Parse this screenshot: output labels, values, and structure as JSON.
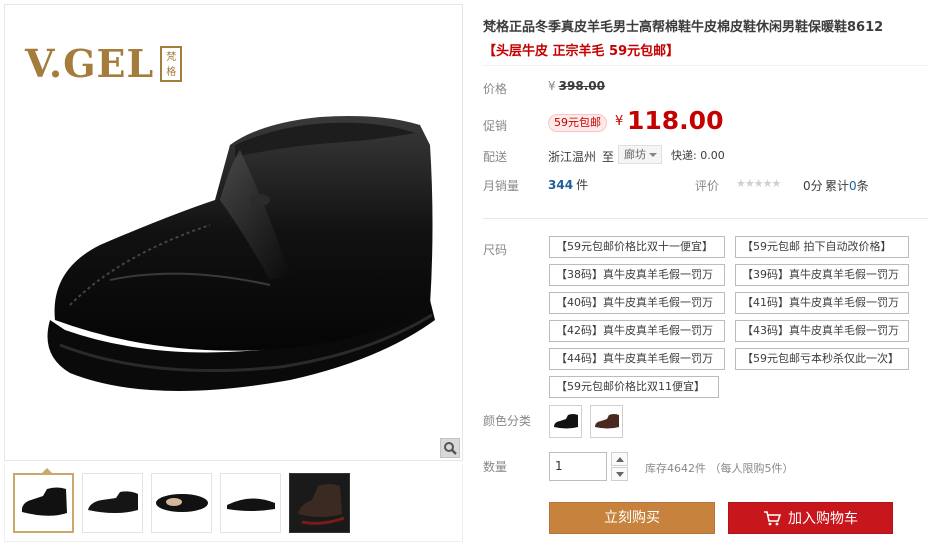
{
  "product": {
    "title": "梵格正品冬季真皮羊毛男士高帮棉鞋牛皮棉皮鞋休闲男鞋保暖鞋8612",
    "subtitle": "【头层牛皮 正宗羊毛 59元包邮】",
    "brand": {
      "logo_text": "V.GEL",
      "seal_text": "梵格"
    }
  },
  "pricing": {
    "price_label": "价格",
    "currency": "¥",
    "original_price": "398.00",
    "promo_label": "促销",
    "promo_badge": "59元包邮",
    "promo_price": "118.00"
  },
  "shipping": {
    "label": "配送",
    "from": "浙江温州",
    "to_word": "至",
    "to_city": "廊坊",
    "fee": "快递: 0.00"
  },
  "sales": {
    "label": "月销量",
    "count": "344",
    "unit": "件",
    "rating_label": "评价",
    "stars": "★★★★★",
    "score": "0分",
    "review_count_prefix": "累计",
    "review_count": "0",
    "review_count_suffix": "条"
  },
  "sizes": {
    "label": "尺码",
    "options": [
      "【59元包邮价格比双十一便宜】",
      "【59元包邮 拍下自动改价格】",
      "【38码】真牛皮真羊毛假一罚万",
      "【39码】真牛皮真羊毛假一罚万",
      "【40码】真牛皮真羊毛假一罚万",
      "【41码】真牛皮真羊毛假一罚万",
      "【42码】真牛皮真羊毛假一罚万",
      "【43码】真牛皮真羊毛假一罚万",
      "【44码】真牛皮真羊毛假一罚万",
      "【59元包邮亏本秒杀仅此一次】",
      "【59元包邮价格比双11便宜】"
    ]
  },
  "colors": {
    "label": "颜色分类",
    "swatch_icons": [
      "black-shoe-swatch",
      "brown-shoe-swatch"
    ]
  },
  "quantity": {
    "label": "数量",
    "value": "1",
    "stock": "库存4642件 （每人限购5件）"
  },
  "actions": {
    "buy_now": "立刻购买",
    "add_to_cart": "加入购物车"
  },
  "theme": {
    "price_red": "#c40000",
    "buy_orange": "#c7833e",
    "cart_red": "#c8161d",
    "brand_gold": "#a47c3b"
  }
}
